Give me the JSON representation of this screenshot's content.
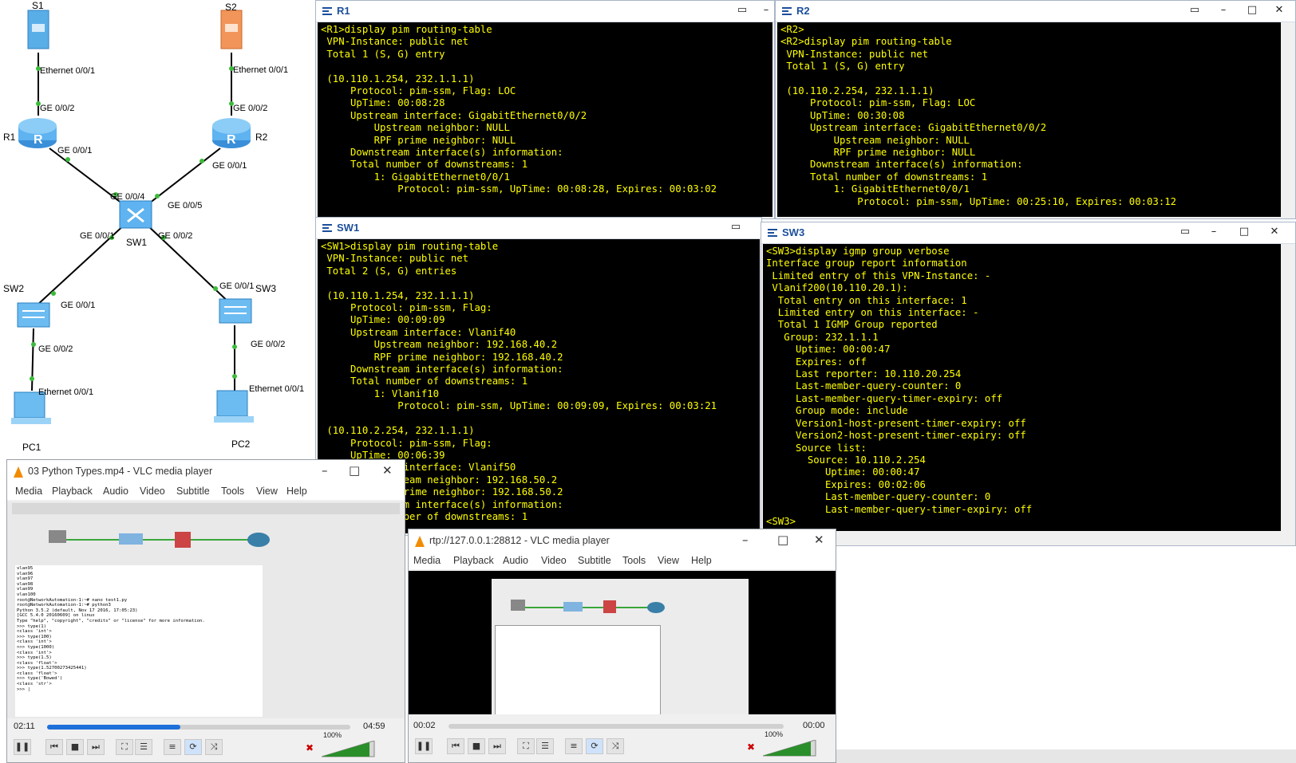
{
  "topology": {
    "nodes": {
      "s1": "S1",
      "s2": "S2",
      "r1": "R1",
      "r2": "R2",
      "sw1": "SW1",
      "sw2": "SW2",
      "sw3": "SW3",
      "pc1": "PC1",
      "pc2": "PC2",
      "router_glyph": "R"
    },
    "ports": {
      "s1_eth": "Ethernet 0/0/1",
      "r1_ge2": "GE 0/0/2",
      "r1_ge1": "GE 0/0/1",
      "s2_eth": "Ethernet 0/0/1",
      "r2_ge2": "GE 0/0/2",
      "r2_ge1": "GE 0/0/1",
      "sw1_ge4": "GE 0/0/4",
      "sw1_ge5": "GE 0/0/5",
      "sw1_ge1": "GE 0/0/1",
      "sw1_ge2": "GE 0/0/2",
      "sw2_ge1": "GE 0/0/1",
      "sw2_ge2": "GE 0/0/2",
      "pc1_eth": "Ethernet 0/0/1",
      "sw3_ge1": "GE 0/0/1",
      "sw3_ge2": "GE 0/0/2",
      "pc2_eth": "Ethernet 0/0/1"
    }
  },
  "terminals": {
    "r1": {
      "title": "R1",
      "output": "<R1>display pim routing-table\n VPN-Instance: public net\n Total 1 (S, G) entry\n\n (10.110.1.254, 232.1.1.1)\n     Protocol: pim-ssm, Flag: LOC\n     UpTime: 00:08:28\n     Upstream interface: GigabitEthernet0/0/2\n         Upstream neighbor: NULL\n         RPF prime neighbor: NULL\n     Downstream interface(s) information:\n     Total number of downstreams: 1\n         1: GigabitEthernet0/0/1\n             Protocol: pim-ssm, UpTime: 00:08:28, Expires: 00:03:02"
    },
    "r2": {
      "title": "R2",
      "output": "<R2>\n<R2>display pim routing-table\n VPN-Instance: public net\n Total 1 (S, G) entry\n\n (10.110.2.254, 232.1.1.1)\n     Protocol: pim-ssm, Flag: LOC\n     UpTime: 00:30:08\n     Upstream interface: GigabitEthernet0/0/2\n         Upstream neighbor: NULL\n         RPF prime neighbor: NULL\n     Downstream interface(s) information:\n     Total number of downstreams: 1\n         1: GigabitEthernet0/0/1\n             Protocol: pim-ssm, UpTime: 00:25:10, Expires: 00:03:12"
    },
    "sw1": {
      "title": "SW1",
      "output": "<SW1>display pim routing-table\n VPN-Instance: public net\n Total 2 (S, G) entries\n\n (10.110.1.254, 232.1.1.1)\n     Protocol: pim-ssm, Flag:\n     UpTime: 00:09:09\n     Upstream interface: Vlanif40\n         Upstream neighbor: 192.168.40.2\n         RPF prime neighbor: 192.168.40.2\n     Downstream interface(s) information:\n     Total number of downstreams: 1\n         1: Vlanif10\n             Protocol: pim-ssm, UpTime: 00:09:09, Expires: 00:03:21\n\n (10.110.2.254, 232.1.1.1)\n     Protocol: pim-ssm, Flag:\n     UpTime: 00:06:39\n     Upstream interface: Vlanif50\n         Upstream neighbor: 192.168.50.2\n         RPF prime neighbor: 192.168.50.2\n     Downstream interface(s) information:\n     Total number of downstreams: 1"
    },
    "sw3": {
      "title": "SW3",
      "output": "<SW3>display igmp group verbose\nInterface group report information\n Limited entry of this VPN-Instance: -\n Vlanif200(10.110.20.1):\n  Total entry on this interface: 1\n  Limited entry on this interface: -\n  Total 1 IGMP Group reported\n   Group: 232.1.1.1\n     Uptime: 00:00:47\n     Expires: off\n     Last reporter: 10.110.20.254\n     Last-member-query-counter: 0\n     Last-member-query-timer-expiry: off\n     Group mode: include\n     Version1-host-present-timer-expiry: off\n     Version2-host-present-timer-expiry: off\n     Source list:\n       Source: 10.110.2.254\n          Uptime: 00:00:47\n          Expires: 00:02:06\n          Last-member-query-counter: 0\n          Last-member-query-timer-expiry: off\n<SW3>"
    }
  },
  "vlc1": {
    "title": "03 Python Types.mp4 - VLC media player",
    "menu": [
      "Media",
      "Playback",
      "Audio",
      "Video",
      "Subtitle",
      "Tools",
      "View",
      "Help"
    ],
    "elapsed": "02:11",
    "total": "04:59",
    "progress": 0.44,
    "volume": "100%",
    "video_terminal": "vlan95\nvlan96\nvlan97\nvlan98\nvlan99\nvlan100\nroot@NetworkAutomation-1:~# nano test1.py\nroot@NetworkAutomation-1:~# python3\nPython 3.5.2 (default, Nov 17 2016, 17:05:23)\n[GCC 5.4.0 20160609] on linux\nType \"help\", \"copyright\", \"credits\" or \"license\" for more information.\n>>> type(1)\n<class 'int'>\n>>> type(100)\n<class 'int'>\n>>> type(1000)\n<class 'int'>\n>>> type(1.5)\n<class 'float'>\n>>> type(1.52700273425441)\n<class 'float'>\n>>> type('Bowed')\n<class 'str'>\n>>> |"
  },
  "vlc2": {
    "title": "rtp://127.0.0.1:28812 - VLC media player",
    "menu": [
      "Media",
      "Playback",
      "Audio",
      "Video",
      "Subtitle",
      "Tools",
      "View",
      "Help"
    ],
    "elapsed": "00:02",
    "total": "00:00",
    "progress": 0.0,
    "volume": "100%"
  }
}
